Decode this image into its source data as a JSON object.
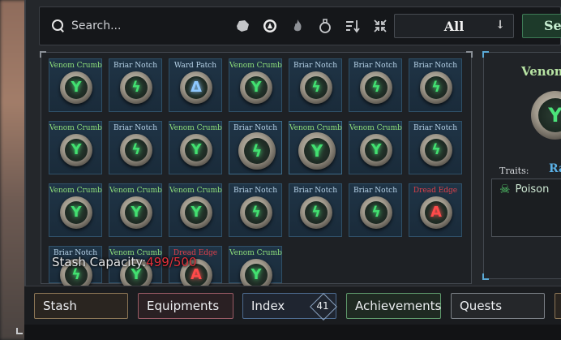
{
  "search": {
    "placeholder": "Search..."
  },
  "filter_icons": [
    "stone-icon",
    "ward-rune-icon",
    "flame-icon",
    "potion-icon",
    "sort-icon",
    "collapse-icon"
  ],
  "dropdown": {
    "selected": "All",
    "arrow": "↓"
  },
  "search_button": {
    "label": "Se"
  },
  "items": [
    {
      "label": "Venom Crumb",
      "color": "#8fe07a",
      "glyph": "Y",
      "glyph_color": "#42e070"
    },
    {
      "label": "Briar Notch",
      "color": "#b8d4ea",
      "glyph": "ϟ",
      "glyph_color": "#42e070"
    },
    {
      "label": "Ward Patch",
      "color": "#b8d4ea",
      "glyph": "Δ",
      "glyph_color": "#8ec8ff"
    },
    {
      "label": "Venom Crumb",
      "color": "#8fe07a",
      "glyph": "Y",
      "glyph_color": "#42e070"
    },
    {
      "label": "Briar Notch",
      "color": "#b8d4ea",
      "glyph": "ϟ",
      "glyph_color": "#42e070"
    },
    {
      "label": "Briar Notch",
      "color": "#b8d4ea",
      "glyph": "ϟ",
      "glyph_color": "#42e070"
    },
    {
      "label": "Briar Notch",
      "color": "#b8d4ea",
      "glyph": "ϟ",
      "glyph_color": "#42e070"
    },
    {
      "label": "Venom Crumb",
      "color": "#8fe07a",
      "glyph": "Y",
      "glyph_color": "#42e070"
    },
    {
      "label": "Briar Notch",
      "color": "#b8d4ea",
      "glyph": "ϟ",
      "glyph_color": "#42e070"
    },
    {
      "label": "Venom Crumb",
      "color": "#8fe07a",
      "glyph": "Y",
      "glyph_color": "#42e070"
    },
    {
      "label": "Briar Notch",
      "color": "#b8d4ea",
      "glyph": "ϟ",
      "glyph_color": "#42e070"
    },
    {
      "label": "Venom Crumb",
      "color": "#8fe07a",
      "glyph": "Y",
      "glyph_color": "#42e070"
    },
    {
      "label": "Venom Crumb",
      "color": "#8fe07a",
      "glyph": "Y",
      "glyph_color": "#42e070"
    },
    {
      "label": "Briar Notch",
      "color": "#b8d4ea",
      "glyph": "ϟ",
      "glyph_color": "#42e070"
    },
    {
      "label": "Venom Crumb",
      "color": "#8fe07a",
      "glyph": "Y",
      "glyph_color": "#42e070"
    },
    {
      "label": "Venom Crumb",
      "color": "#8fe07a",
      "glyph": "Y",
      "glyph_color": "#42e070"
    },
    {
      "label": "Venom Crumb",
      "color": "#8fe07a",
      "glyph": "Y",
      "glyph_color": "#42e070"
    },
    {
      "label": "Briar Notch",
      "color": "#b8d4ea",
      "glyph": "ϟ",
      "glyph_color": "#42e070"
    },
    {
      "label": "Briar Notch",
      "color": "#b8d4ea",
      "glyph": "ϟ",
      "glyph_color": "#42e070"
    },
    {
      "label": "Briar Notch",
      "color": "#b8d4ea",
      "glyph": "ϟ",
      "glyph_color": "#42e070"
    },
    {
      "label": "Dread Edge",
      "color": "#e0404a",
      "glyph": "A",
      "glyph_color": "#ff4a4a"
    },
    {
      "label": "Briar Notch",
      "color": "#b8d4ea",
      "glyph": "ϟ",
      "glyph_color": "#42e070"
    },
    {
      "label": "Venom Crumb",
      "color": "#8fe07a",
      "glyph": "Y",
      "glyph_color": "#42e070"
    },
    {
      "label": "Dread Edge",
      "color": "#e0404a",
      "glyph": "A",
      "glyph_color": "#ff4a4a"
    },
    {
      "label": "Venom Crumb",
      "color": "#8fe07a",
      "glyph": "Y",
      "glyph_color": "#42e070"
    }
  ],
  "detail": {
    "title": "Venom",
    "traits_label": "Traits:",
    "rarity": "Ra",
    "trait": "Poison",
    "glyph": "Y"
  },
  "stash_capacity": {
    "label": "Stash Capacity:",
    "value": "499/500"
  },
  "tabs": {
    "stash": "Stash",
    "equipments": "Equipments",
    "index": "Index",
    "index_badge": "41",
    "achievements": "Achievements",
    "quests": "Quests"
  }
}
